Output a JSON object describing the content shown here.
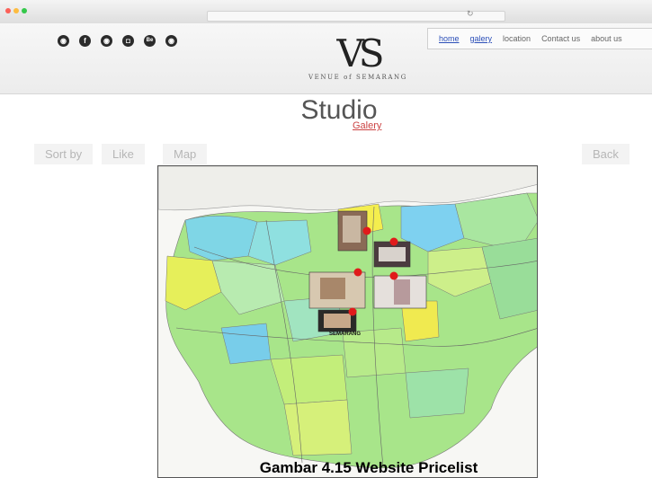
{
  "browser": {
    "dots": [
      "#fc6058",
      "#fdbc40",
      "#34c84a"
    ]
  },
  "social_icons": [
    {
      "name": "social-icon-1",
      "glyph": "◉"
    },
    {
      "name": "facebook-icon",
      "glyph": "f"
    },
    {
      "name": "social-icon-3",
      "glyph": "◉"
    },
    {
      "name": "instagram-icon",
      "glyph": "◘"
    },
    {
      "name": "behance-icon",
      "glyph": "Be"
    },
    {
      "name": "social-icon-6",
      "glyph": "◉"
    }
  ],
  "logo": {
    "mark": "VS",
    "subtitle": "VENUE of SEMARANG"
  },
  "nav": {
    "home": "home",
    "galery": "galery",
    "location": "location",
    "contact": "Contact us",
    "about": "about us"
  },
  "page": {
    "title": "Studio",
    "subtitle": "Galery"
  },
  "buttons": {
    "sort": "Sort by",
    "like": "Like",
    "map": "Map",
    "back": "Back"
  },
  "map": {
    "city_label": "SEMARANG"
  },
  "caption": "Gambar 4.15 Website Pricelist"
}
